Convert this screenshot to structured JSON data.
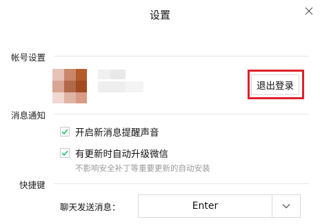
{
  "window": {
    "title": "设置",
    "close_icon": "close-icon"
  },
  "account": {
    "section_label": "帐号设置",
    "logout_label": "退出登录"
  },
  "notifications": {
    "section_label": "消息通知",
    "items": [
      {
        "label": "开启新消息提醒声音",
        "checked": true
      },
      {
        "label": "有更新时自动升级微信",
        "checked": true
      }
    ],
    "update_hint": "不影响安全补丁等重要更新的自动安装"
  },
  "shortcuts": {
    "section_label": "快捷键",
    "send_label": "聊天发送消息：",
    "send_value": "Enter"
  },
  "colors": {
    "accent_check": "#07c160",
    "highlight": "#e0202a"
  }
}
